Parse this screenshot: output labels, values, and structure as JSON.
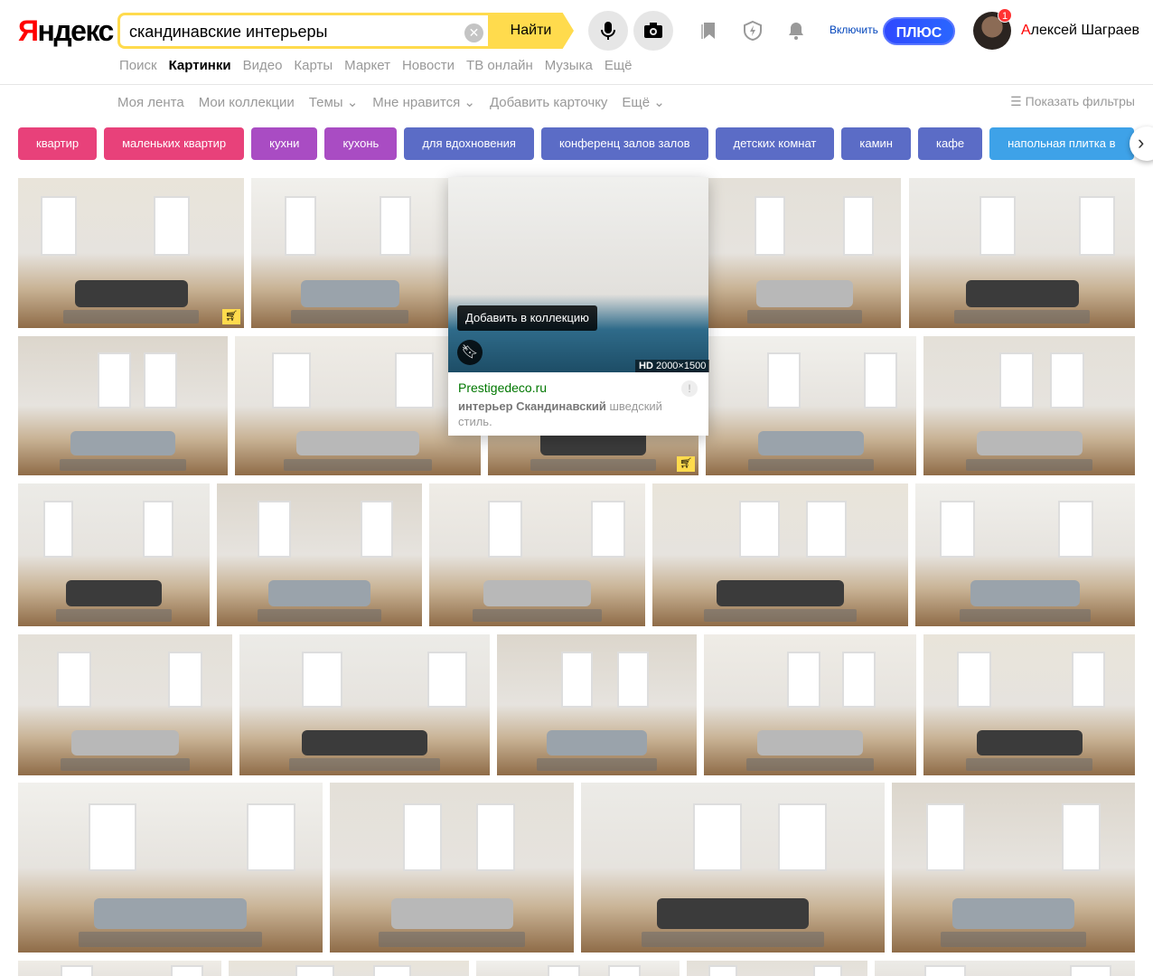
{
  "header": {
    "logo_y": "Я",
    "logo_rest": "ндекс",
    "search_query": "скандинавские интерьеры",
    "search_button": "Найти",
    "plus_label": "Включить",
    "plus_button": "ПЛЮС",
    "notifications_count": "1",
    "user_first_letter": "А",
    "user_rest": "лексей Шаграев"
  },
  "services": [
    "Поиск",
    "Картинки",
    "Видео",
    "Карты",
    "Маркет",
    "Новости",
    "ТВ онлайн",
    "Музыка",
    "Ещё"
  ],
  "subnav": [
    "Моя лента",
    "Мои коллекции",
    "Темы ⌄",
    "Мне нравится ⌄",
    "Добавить карточку",
    "Ещё ⌄"
  ],
  "filters_label": "Показать фильтры",
  "chips": [
    {
      "label": "квартир",
      "color": "#e8417a"
    },
    {
      "label": "маленьких квартир",
      "color": "#e8417a"
    },
    {
      "label": "кухни",
      "color": "#a94cc3"
    },
    {
      "label": "кухонь",
      "color": "#a94cc3"
    },
    {
      "label": "для вдохновения",
      "color": "#5b6cc6"
    },
    {
      "label": "конференц залов залов",
      "color": "#5b6cc6"
    },
    {
      "label": "детских комнат",
      "color": "#5b6cc6"
    },
    {
      "label": "камин",
      "color": "#5b6cc6"
    },
    {
      "label": "кафе",
      "color": "#5b6cc6"
    },
    {
      "label": "напольная плитка в",
      "color": "#3ea2e8"
    }
  ],
  "popup": {
    "tooltip": "Добавить в коллекцию",
    "hd_label": "HD",
    "resolution": "2000×1500",
    "domain": "Prestigedeco.ru",
    "desc_bold": "интерьер Скандинавский",
    "desc_rest": " шведский стиль."
  }
}
